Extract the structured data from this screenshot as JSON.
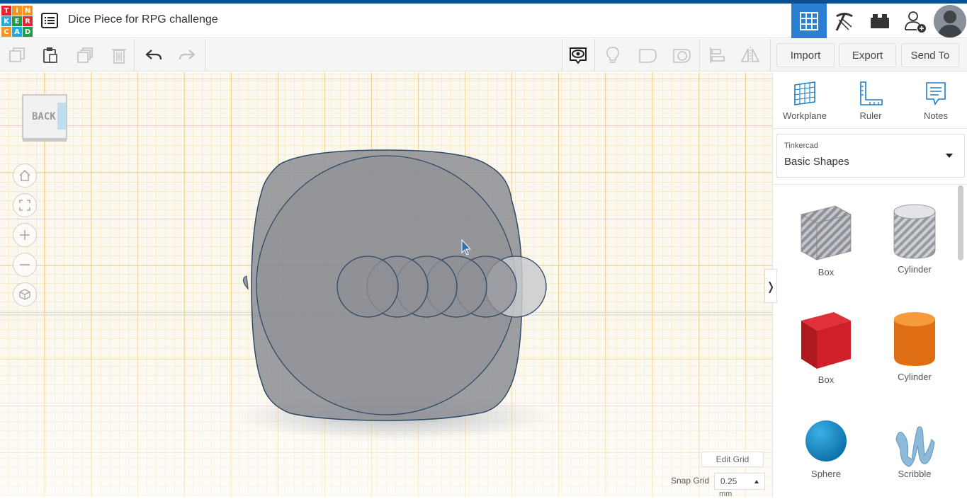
{
  "header": {
    "logo_letters": [
      "T",
      "I",
      "N",
      "K",
      "E",
      "R",
      "C",
      "A",
      "D"
    ],
    "logo_colors": [
      "#e5242b",
      "#f7941d",
      "#f7941d",
      "#25a9e0",
      "#1f9b4b",
      "#e5242b",
      "#f7941d",
      "#25a9e0",
      "#1f9b4b"
    ],
    "title": "Dice Piece for RPG challenge",
    "nav_buttons": [
      {
        "name": "3d-design-view-button",
        "icon": "grid-icon",
        "active": true
      },
      {
        "name": "blocks-view-button",
        "icon": "pickaxe-icon",
        "active": false
      },
      {
        "name": "bricks-view-button",
        "icon": "brick-icon",
        "active": false
      },
      {
        "name": "invite-user-button",
        "icon": "add-user-icon",
        "active": false
      }
    ]
  },
  "toolbar": {
    "edit_icons": [
      "copy-icon",
      "paste-icon",
      "duplicate-icon",
      "delete-icon",
      "undo-icon",
      "redo-icon"
    ],
    "view_icons": [
      "show-all-icon",
      "light-icon",
      "shape-outline-icon",
      "shape-hole-icon",
      "align-icon",
      "mirror-icon"
    ],
    "import_label": "Import",
    "export_label": "Export",
    "send_to_label": "Send To"
  },
  "workplane": {
    "viewcube_label": "BACK",
    "nav_icons": [
      "home-icon",
      "fit-view-icon",
      "zoom-in-icon",
      "zoom-out-icon",
      "perspective-icon"
    ],
    "edit_grid_label": "Edit Grid",
    "snap_grid_label": "Snap Grid",
    "snap_grid_value": "0.25",
    "snap_grid_unit": "mm",
    "collapse_glyph": "❭",
    "grid_colors": {
      "minor": "#f2cf7e",
      "major": "#e7b44c",
      "background": "#fbf8ef"
    }
  },
  "panel": {
    "tools": [
      {
        "label": "Workplane",
        "icon": "workplane-icon"
      },
      {
        "label": "Ruler",
        "icon": "ruler-icon"
      },
      {
        "label": "Notes",
        "icon": "notes-icon"
      }
    ],
    "library_small": "Tinkercad",
    "library_main": "Basic Shapes",
    "shapes": [
      {
        "label": "Box",
        "icon": "box-hole-icon"
      },
      {
        "label": "Cylinder",
        "icon": "cylinder-hole-icon"
      },
      {
        "label": "Box",
        "icon": "box-solid-icon",
        "color": "#d71f27"
      },
      {
        "label": "Cylinder",
        "icon": "cylinder-solid-icon",
        "color": "#e8751a"
      },
      {
        "label": "Sphere",
        "icon": "sphere-icon",
        "color": "#1a8bc9"
      },
      {
        "label": "Scribble",
        "icon": "scribble-icon",
        "color": "#88b7d9"
      }
    ]
  },
  "accent_color": "#2a7fd4"
}
